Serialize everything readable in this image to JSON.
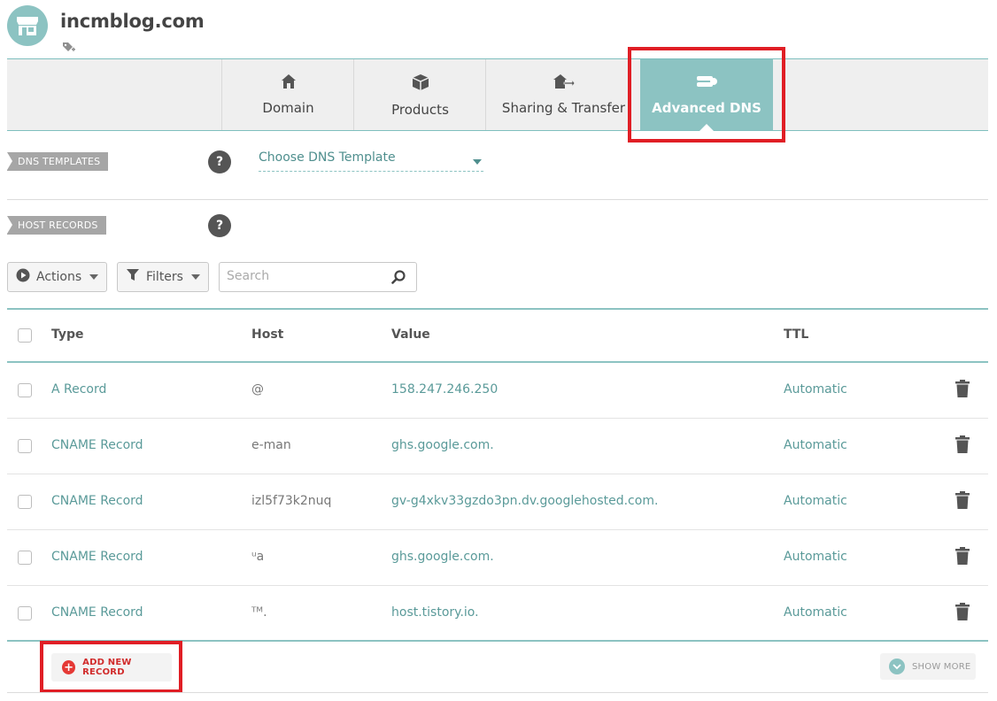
{
  "header": {
    "domain": "incmblog.com"
  },
  "tabs": [
    {
      "label": "Domain",
      "icon": "home-icon",
      "active": false
    },
    {
      "label": "Products",
      "icon": "box-icon",
      "active": false
    },
    {
      "label": "Sharing & Transfer",
      "icon": "house-transfer-icon",
      "active": false
    },
    {
      "label": "Advanced DNS",
      "icon": "server-icon",
      "active": true
    }
  ],
  "dns_templates": {
    "tag": "DNS TEMPLATES",
    "help": "?",
    "select_value": "Choose DNS Template"
  },
  "host_records": {
    "tag": "HOST RECORDS",
    "help": "?"
  },
  "toolbar": {
    "actions_label": "Actions",
    "filters_label": "Filters",
    "search_placeholder": "Search"
  },
  "table": {
    "columns": [
      "Type",
      "Host",
      "Value",
      "TTL"
    ],
    "rows": [
      {
        "type": "A Record",
        "host": "@",
        "value": "158.247.246.250",
        "ttl": "Automatic"
      },
      {
        "type": "CNAME Record",
        "host": "e-man",
        "value": "ghs.google.com.",
        "ttl": "Automatic"
      },
      {
        "type": "CNAME Record",
        "host": "izl5f73k2nuq",
        "value": "gv-g4xkv33gzdo3pn.dv.googlehosted.com.",
        "ttl": "Automatic"
      },
      {
        "type": "CNAME Record",
        "host": "ᵘa",
        "value": "ghs.google.com.",
        "ttl": "Automatic"
      },
      {
        "type": "CNAME Record",
        "host": "ᵀᴹ․",
        "value": "host.tistory.io.",
        "ttl": "Automatic"
      }
    ]
  },
  "footer": {
    "add_label": "ADD NEW RECORD",
    "show_more_label": "SHOW MORE"
  },
  "colors": {
    "accent": "#8cc3c2",
    "highlight": "#e01e25",
    "link": "#5a9a99"
  }
}
